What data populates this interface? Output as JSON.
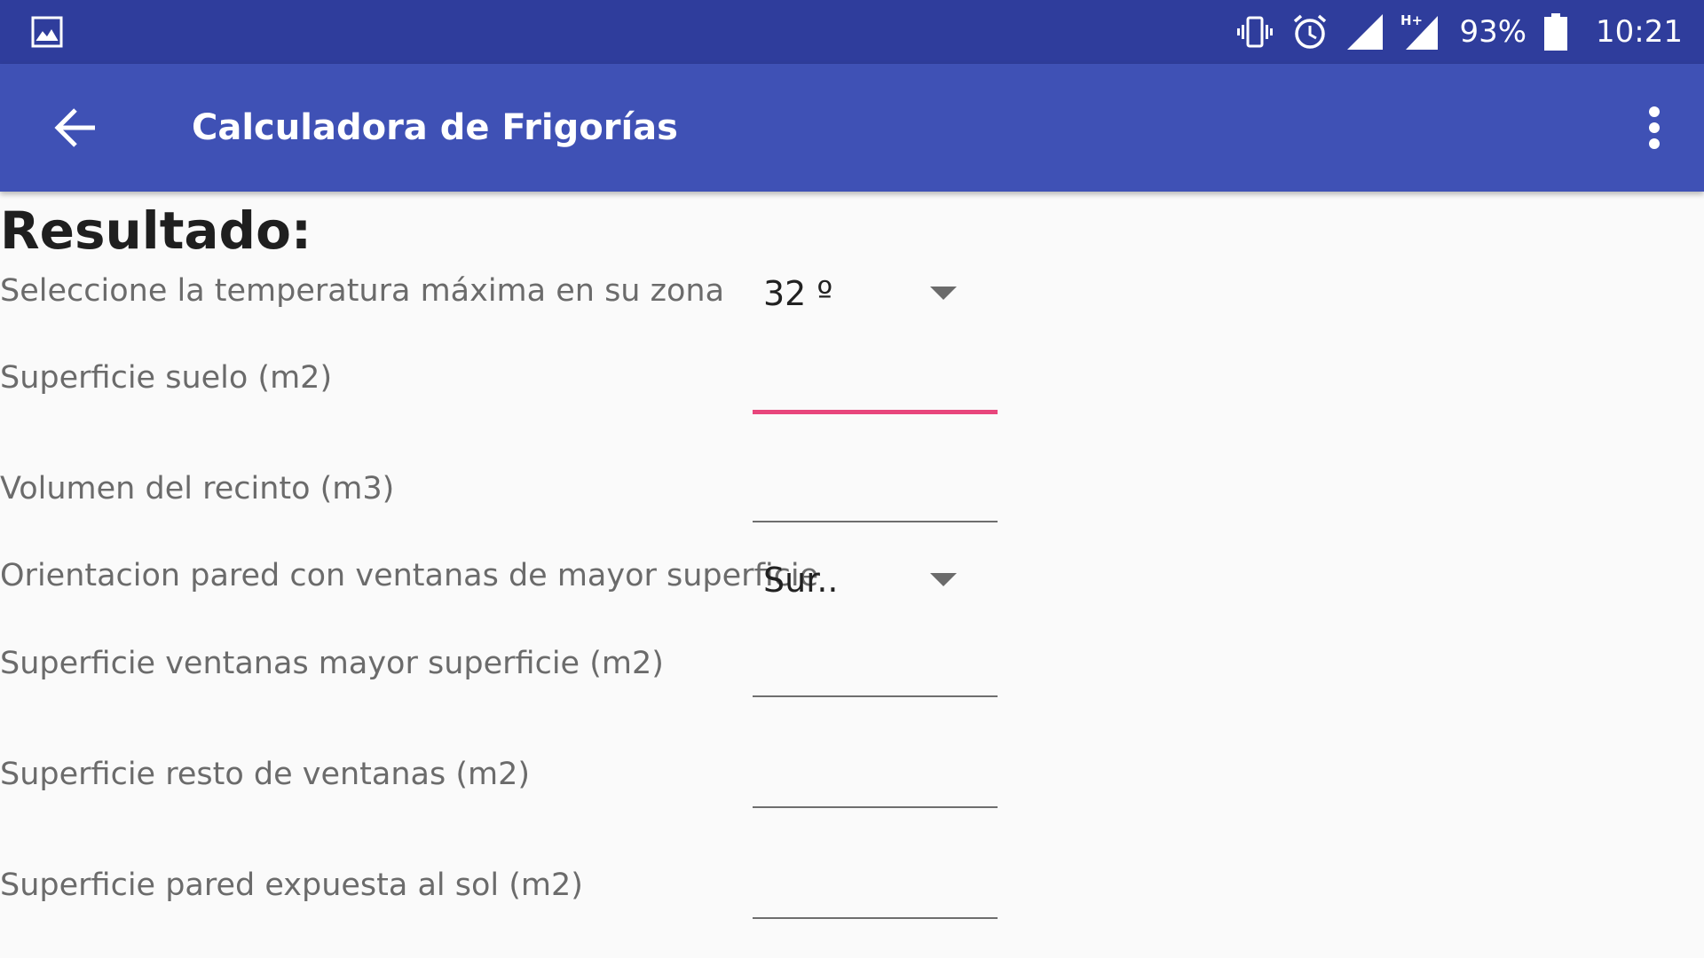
{
  "status_bar": {
    "left_icon": "image-notification-icon",
    "icons": [
      "vibrate-icon",
      "alarm-icon",
      "signal-icon",
      "h-plus-signal-icon"
    ],
    "network_type": "H+",
    "battery_percent": "93%",
    "battery_icon": "battery-icon",
    "time": "10:21"
  },
  "app_bar": {
    "back_icon": "back-arrow-icon",
    "title": "Calculadora de Frigorías",
    "menu_icon": "overflow-menu-icon"
  },
  "colors": {
    "status_bar": "#2f3d9c",
    "app_bar": "#3f51b5",
    "accent": "#e8467c",
    "background": "#fafafa"
  },
  "form": {
    "heading": "Resultado:",
    "temperature": {
      "label": "Seleccione la temperatura máxima en su zona",
      "selected": "32 º"
    },
    "floor_area": {
      "label": "Superficie suelo (m2)",
      "value": "",
      "focused": true
    },
    "room_volume": {
      "label": "Volumen del recinto (m3)",
      "value": ""
    },
    "orientation": {
      "label": "Orientacion pared con ventanas de mayor superficie",
      "selected": "Sur.."
    },
    "largest_window_area": {
      "label": "Superficie ventanas mayor superficie (m2)",
      "value": ""
    },
    "other_windows_area": {
      "label": "Superficie resto de ventanas (m2)",
      "value": ""
    },
    "sun_wall_area": {
      "label": "Superficie pared expuesta al sol (m2)",
      "value": ""
    }
  }
}
